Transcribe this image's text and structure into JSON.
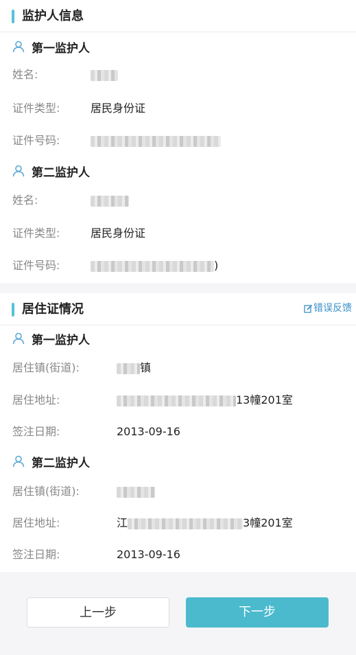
{
  "guardian_info": {
    "title": "监护人信息",
    "first": {
      "heading": "第一监护人",
      "name_label": "姓名:",
      "id_type_label": "证件类型:",
      "id_type_value": "居民身份证",
      "id_number_label": "证件号码:",
      "id_number_suffix": ""
    },
    "second": {
      "heading": "第二监护人",
      "name_label": "姓名:",
      "id_type_label": "证件类型:",
      "id_type_value": "居民身份证",
      "id_number_label": "证件号码:",
      "id_number_suffix": ")"
    }
  },
  "residence": {
    "title": "居住证情况",
    "report_link": "错误反馈",
    "first": {
      "heading": "第一监护人",
      "town_label": "居住镇(街道):",
      "town_suffix": "镇",
      "address_label": "居住地址:",
      "address_suffix": "13幢201室",
      "date_label": "签注日期:",
      "date_value": "2013-09-16"
    },
    "second": {
      "heading": "第二监护人",
      "town_label": "居住镇(街道):",
      "town_suffix": "",
      "address_label": "居住地址:",
      "address_prefix": "江",
      "address_suffix": "3幢201室",
      "date_label": "签注日期:",
      "date_value": "2013-09-16"
    }
  },
  "buttons": {
    "prev": "上一步",
    "next": "下一步"
  },
  "colors": {
    "accent": "#54c3d8",
    "next_button": "#4bbacd",
    "link": "#3a8fc7"
  }
}
